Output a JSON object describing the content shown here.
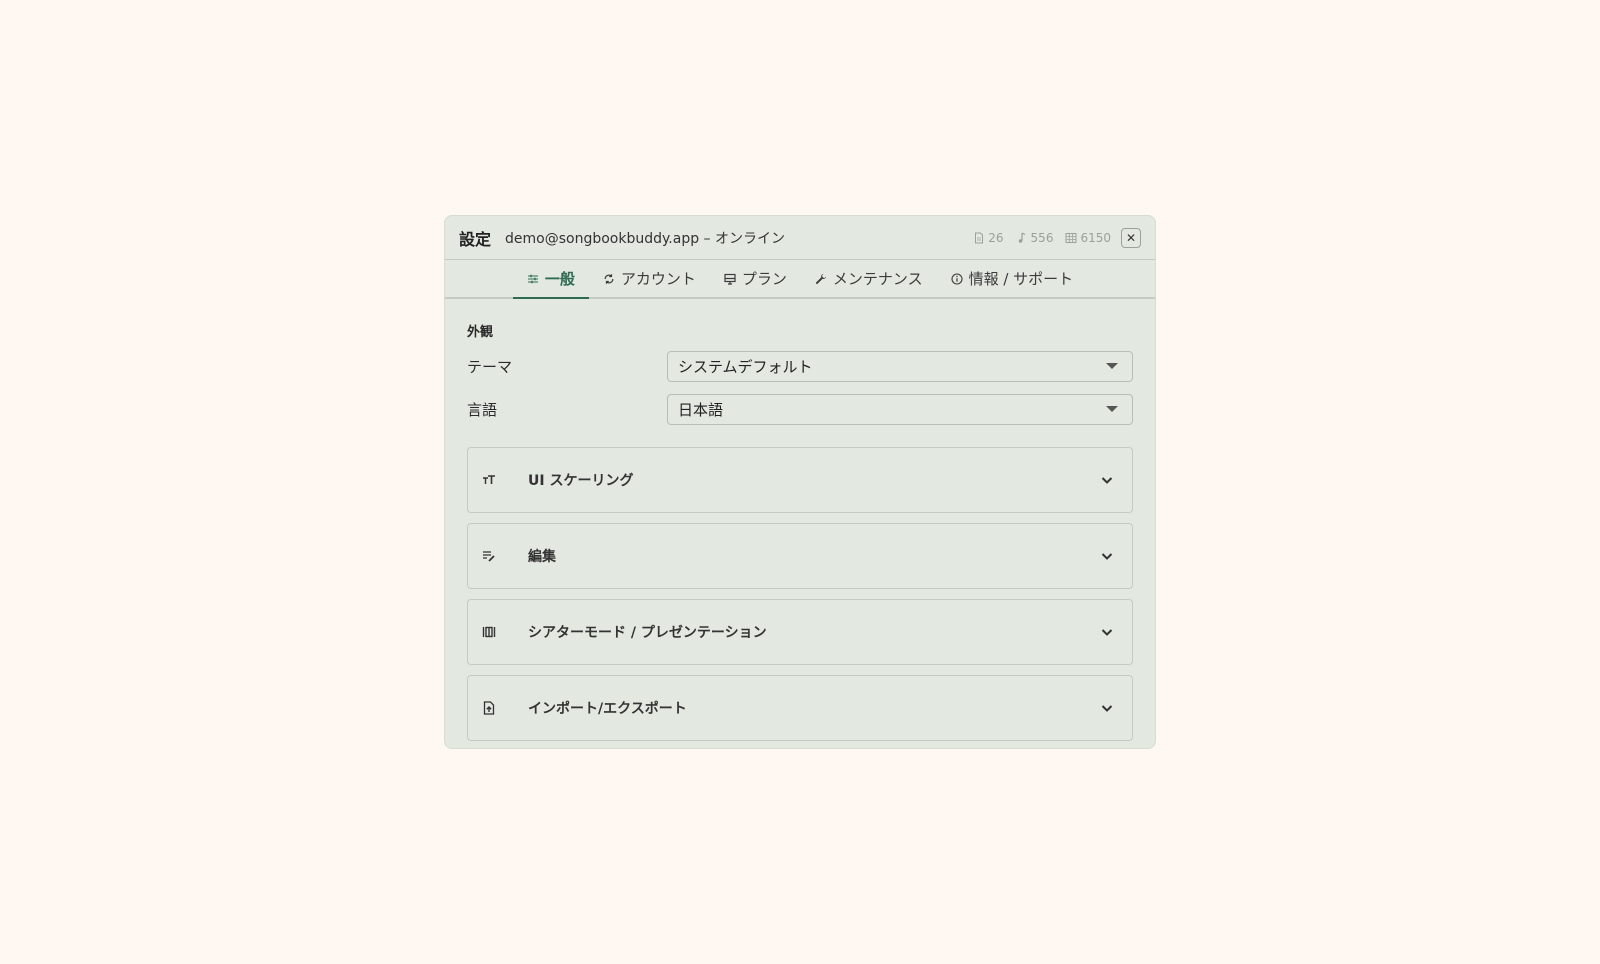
{
  "header": {
    "title": "設定",
    "subtitle": "demo@songbookbuddy.app – オンライン",
    "stats": {
      "documents": "26",
      "songs": "556",
      "entries": "6150"
    },
    "close_label": "✕"
  },
  "tabs": [
    {
      "label": "一般",
      "icon": "sliders-icon",
      "active": true
    },
    {
      "label": "アカウント",
      "icon": "sync-icon",
      "active": false
    },
    {
      "label": "プラン",
      "icon": "monitor-icon",
      "active": false
    },
    {
      "label": "メンテナンス",
      "icon": "wrench-icon",
      "active": false
    },
    {
      "label": "情報 / サポート",
      "icon": "info-icon",
      "active": false
    }
  ],
  "appearance": {
    "section_title": "外観",
    "theme_label": "テーマ",
    "theme_value": "システムデフォルト",
    "language_label": "言語",
    "language_value": "日本語"
  },
  "accordions": [
    {
      "label": "UI スケーリング",
      "icon": "text-size-icon"
    },
    {
      "label": "編集",
      "icon": "edit-lines-icon"
    },
    {
      "label": "シアターモード / プレゼンテーション",
      "icon": "theater-icon"
    },
    {
      "label": "インポート/エクスポート",
      "icon": "file-upload-icon"
    }
  ],
  "colors": {
    "accent": "#2e6b52",
    "panel_bg": "#e3e8e1",
    "page_bg": "#fff8f2"
  }
}
